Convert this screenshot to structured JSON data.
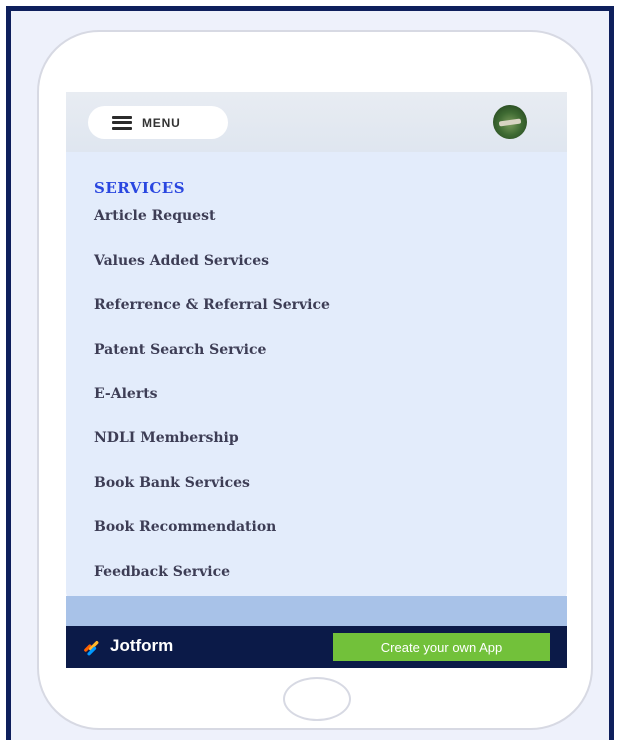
{
  "header": {
    "menu_label": "MENU",
    "icons": {
      "menu": "hamburger-icon",
      "avatar": "profile-avatar-icon"
    }
  },
  "panel": {
    "title": "SERVICES",
    "items": [
      "Article Request",
      "Values Added Services",
      "Referrence & Referral Service",
      "Patent Search Service",
      "E-Alerts",
      "NDLI Membership",
      "Book Bank Services",
      "Book Recommendation",
      "Feedback Service"
    ]
  },
  "footer": {
    "brand": "Jotform",
    "cta": "Create your own App",
    "logo_icon": "jotform-logo-icon"
  },
  "colors": {
    "accent": "#2a47e0",
    "footer_bg": "#0b1a48",
    "cta_bg": "#72c13a",
    "panel_bg": "#e3ecfb"
  }
}
